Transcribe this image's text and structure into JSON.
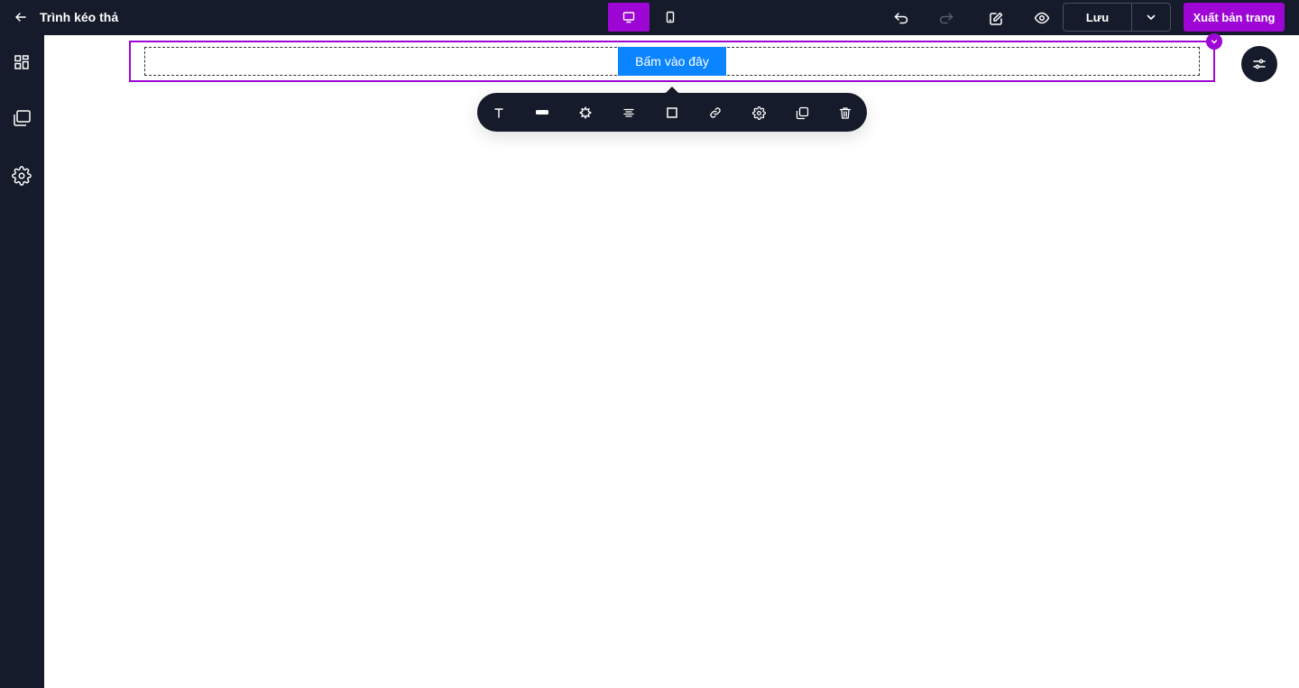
{
  "header": {
    "title": "Trình kéo thả",
    "save_label": "Lưu",
    "publish_label": "Xuất bản trang",
    "active_device": "desktop"
  },
  "icons": {
    "back": "arrow-left-icon",
    "desktop": "monitor-icon",
    "mobile": "smartphone-icon",
    "undo": "undo-icon",
    "redo": "redo-icon",
    "edit": "edit-icon",
    "preview": "eye-icon",
    "save_dropdown": "chevron-down-icon"
  },
  "sidebar": {
    "items": [
      {
        "icon": "layout-grid-icon"
      },
      {
        "icon": "copy-pages-icon"
      },
      {
        "icon": "gear-icon"
      }
    ]
  },
  "canvas": {
    "button_text": "Bấm vào đây",
    "button_color": "#0a84ff",
    "selection_color": "#9d06d4"
  },
  "element_toolbar": {
    "tools": [
      "text-icon",
      "button-style-icon",
      "effect-icon",
      "align-icon",
      "border-icon",
      "link-icon",
      "settings-icon",
      "duplicate-icon",
      "delete-icon"
    ]
  },
  "colors": {
    "dark": "#161b2b",
    "accent": "#9d06d4",
    "white": "#ffffff"
  }
}
